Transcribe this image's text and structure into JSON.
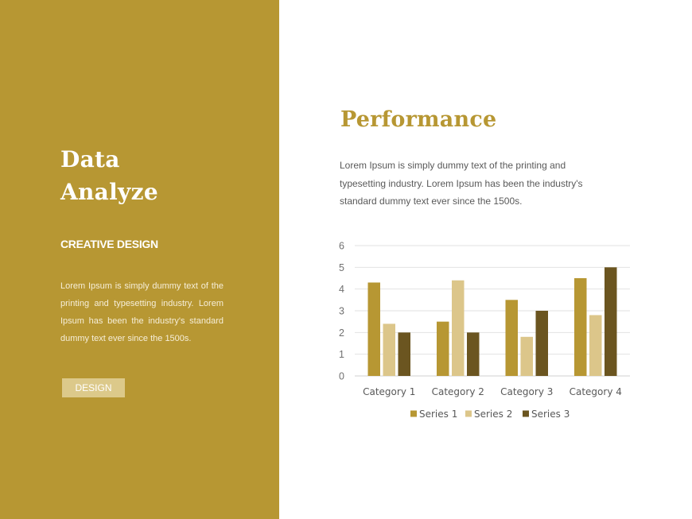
{
  "left": {
    "title_line1": "Data",
    "title_line2": "Analyze",
    "subtitle": "CREATIVE DESIGN",
    "body": "Lorem Ipsum is simply dummy text of the printing and typesetting industry. Lorem Ipsum has been the industry's standard dummy text ever since the 1500s.",
    "button_label": "DESIGN"
  },
  "right": {
    "title": "Performance",
    "body": "Lorem Ipsum is simply dummy text of the printing and typesetting industry. Lorem Ipsum has been the industry's standard dummy text ever since the 1500s."
  },
  "colors": {
    "accent": "#b79733",
    "panel": "#b79733",
    "button": "#dcc98a"
  },
  "chart_data": {
    "type": "bar",
    "title": "",
    "xlabel": "",
    "ylabel": "",
    "categories": [
      "Category 1",
      "Category 2",
      "Category 3",
      "Category 4"
    ],
    "series": [
      {
        "name": "Series 1",
        "color": "#b79733",
        "values": [
          4.3,
          2.5,
          3.5,
          4.5
        ]
      },
      {
        "name": "Series 2",
        "color": "#dcc68a",
        "values": [
          2.4,
          4.4,
          1.8,
          2.8
        ]
      },
      {
        "name": "Series 3",
        "color": "#6b5520",
        "values": [
          2,
          2,
          3,
          5
        ]
      }
    ],
    "ylim": [
      0,
      6
    ],
    "yticks": [
      "0",
      "1",
      "2",
      "3",
      "4",
      "5",
      "6"
    ],
    "grid": true,
    "legend_position": "bottom"
  }
}
